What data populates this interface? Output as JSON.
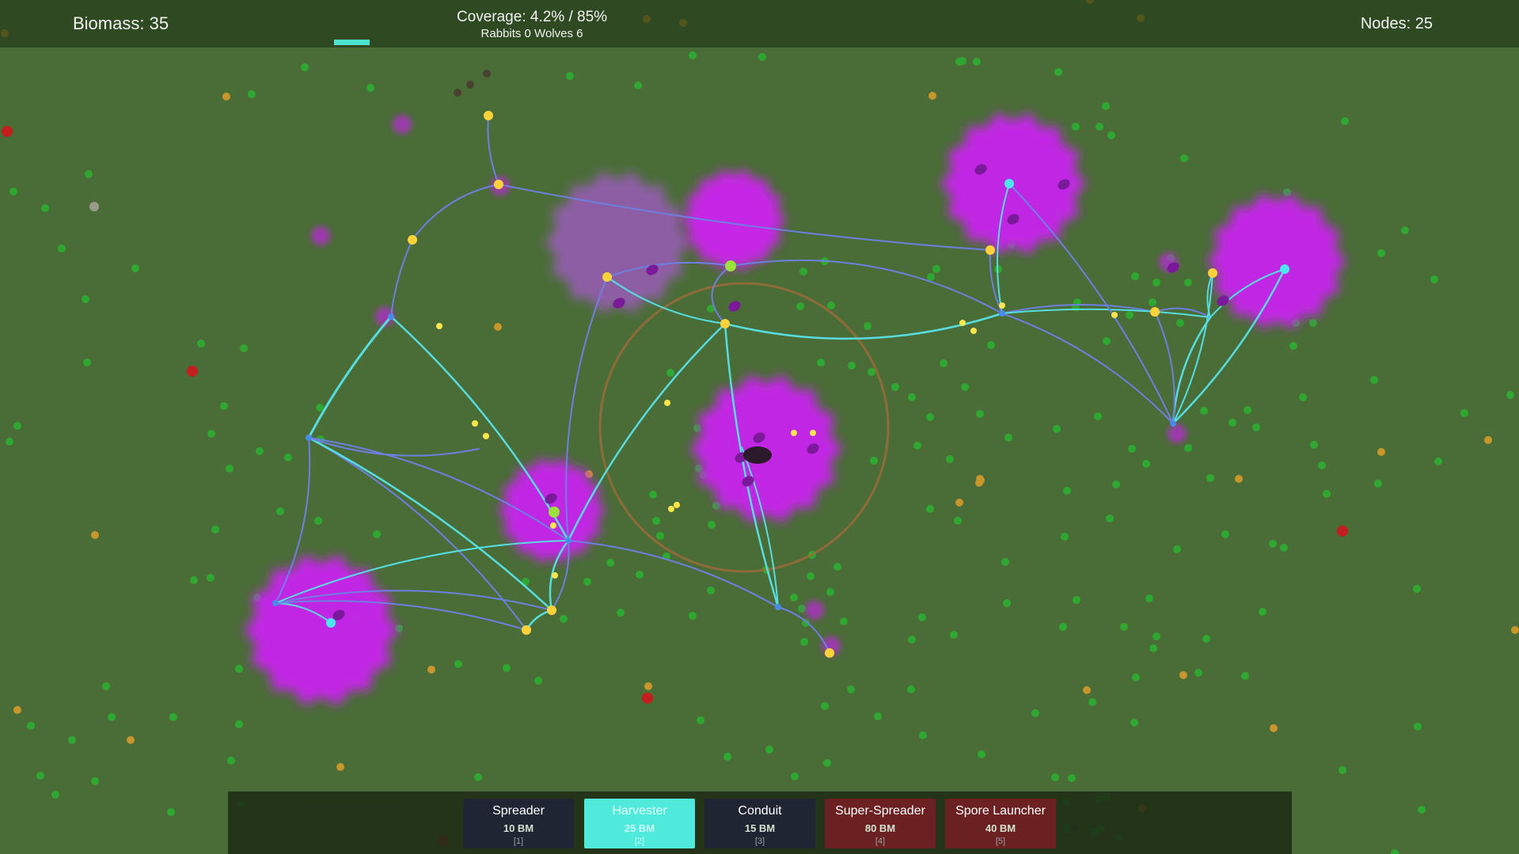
{
  "hud": {
    "biomass": "Biomass: 35",
    "coverage": "Coverage: 4.2%  /  85%",
    "counts": "Rabbits 0  Wolves 6",
    "nodes": "Nodes: 25"
  },
  "toolbar": {
    "tools": [
      {
        "name": "Spreader",
        "cost": "10 BM",
        "key": "[1]"
      },
      {
        "name": "Harvester",
        "cost": "25 BM",
        "key": "[2]"
      },
      {
        "name": "Conduit",
        "cost": "15 BM",
        "key": "[3]"
      },
      {
        "name": "Super-Spreader",
        "cost": "80 BM",
        "key": "[4]"
      },
      {
        "name": "Spore Launcher",
        "cost": "40 BM",
        "key": "[5]"
      }
    ],
    "selected": "Harvester"
  },
  "colors": {
    "ground": "#4a6d37",
    "mycelium": "#cc33ee",
    "link": "#55dde0",
    "link_secondary": "#6d7fe0",
    "node_yellow": "#ffd23a",
    "node_cyan": "#4ae8ee",
    "node_green": "#9be23a",
    "selected_tool": "#4feadb",
    "locked_tool": "#6b2121"
  }
}
